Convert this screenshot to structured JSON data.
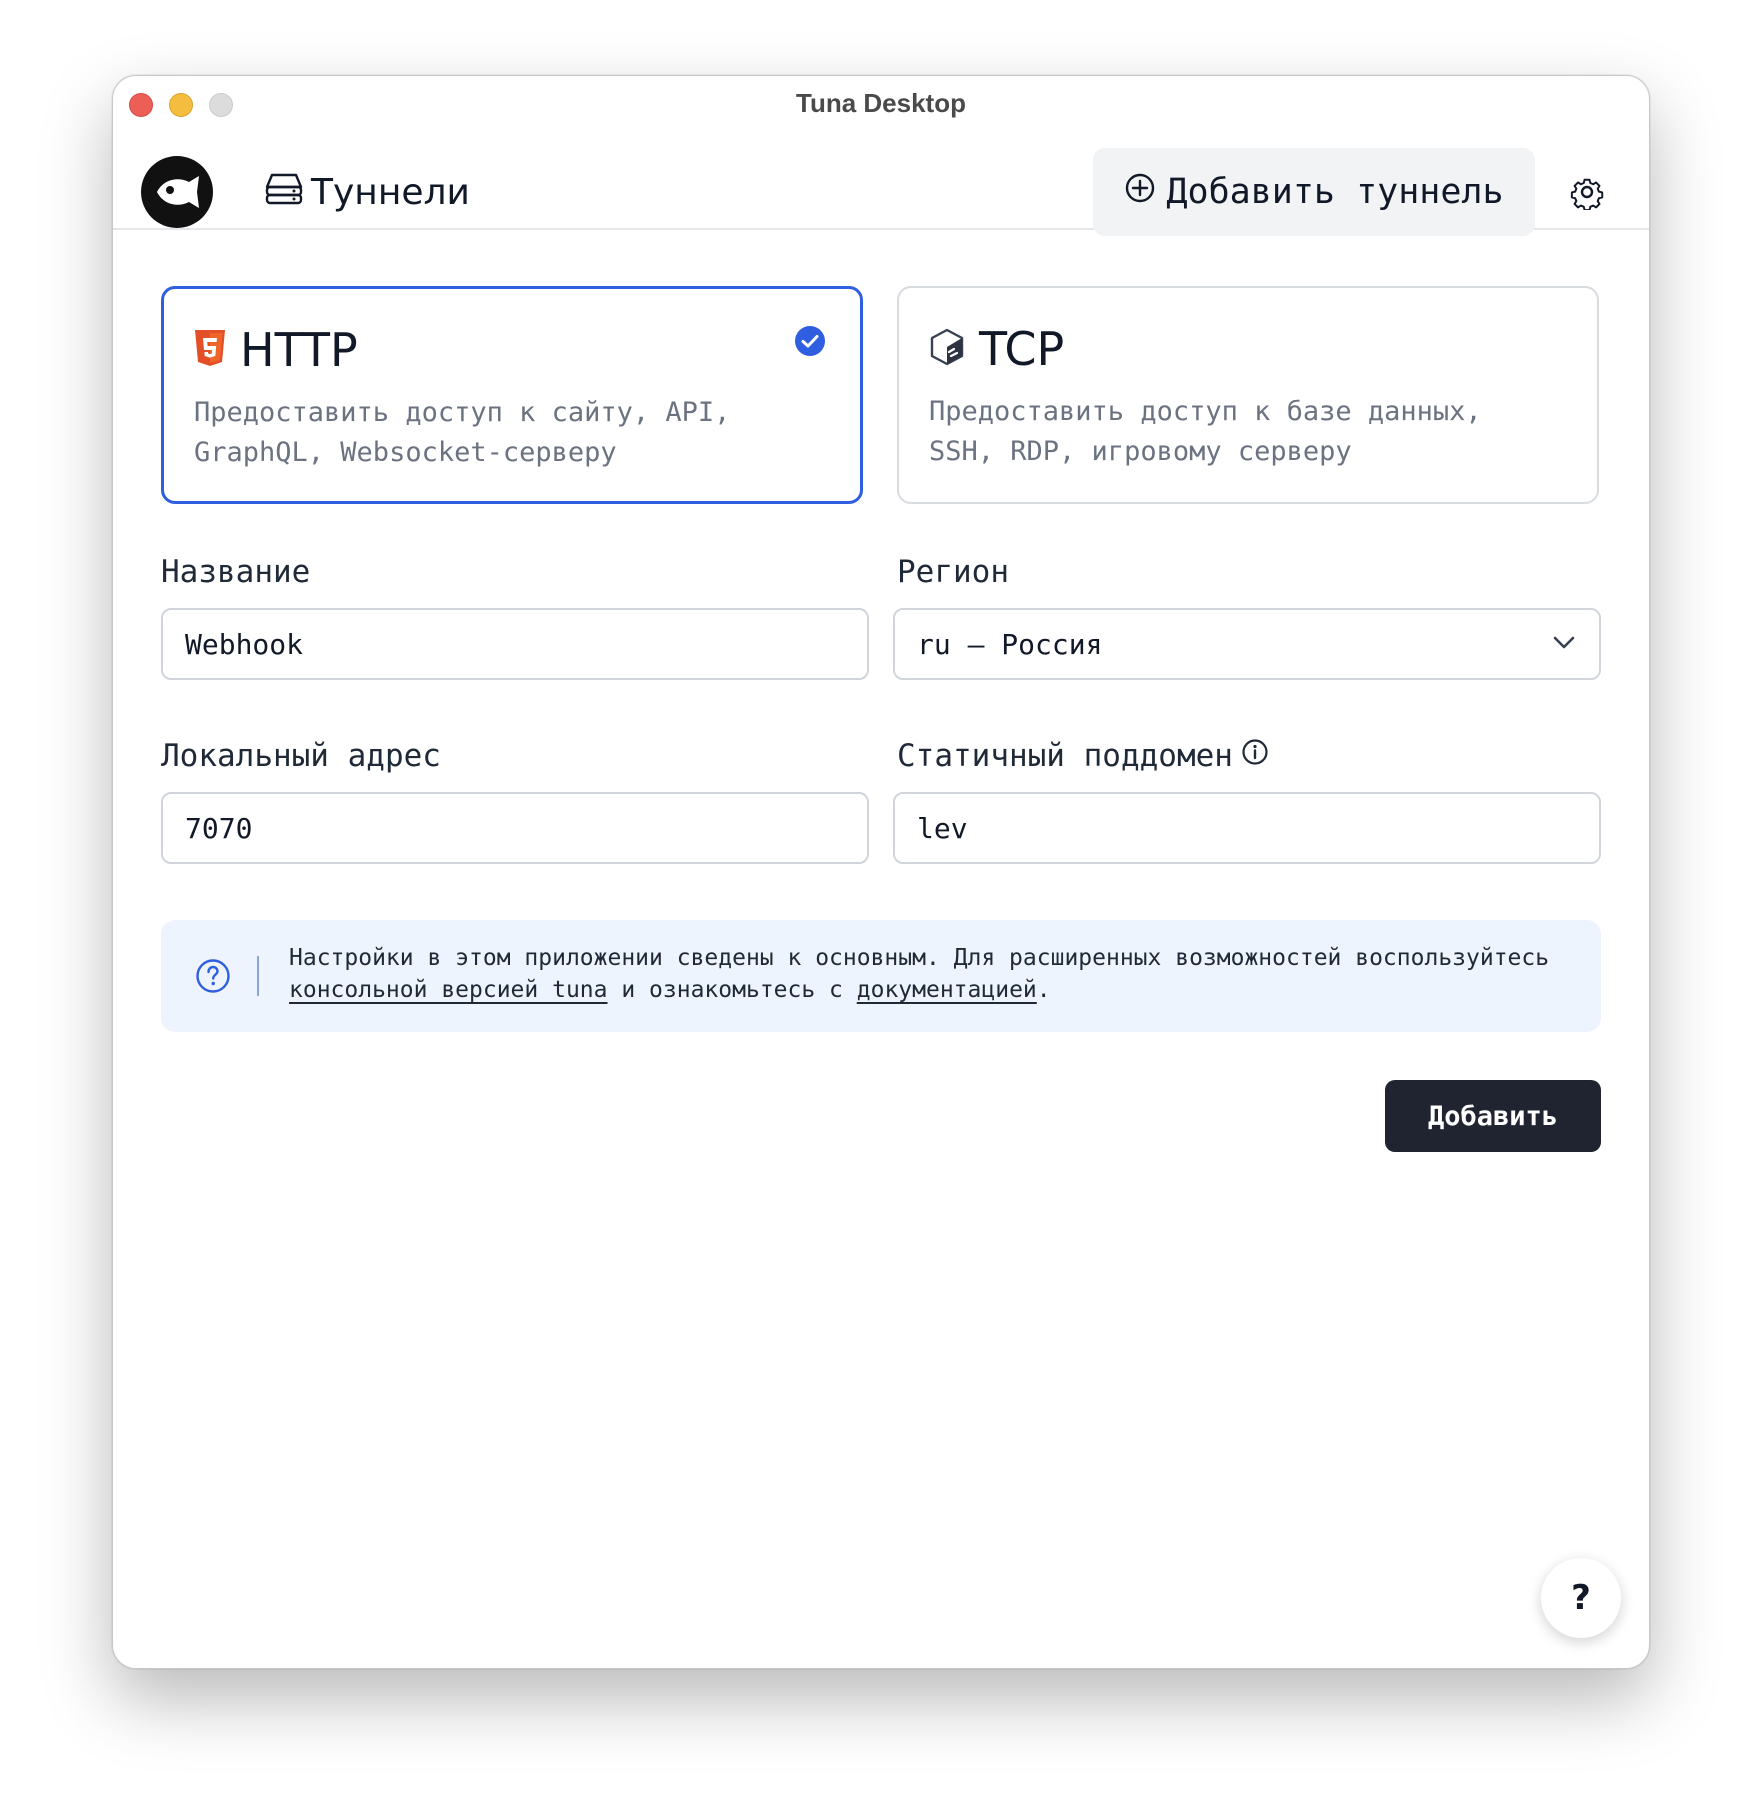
{
  "window": {
    "title": "Tuna Desktop"
  },
  "header": {
    "logo_icon": "fish-logo-icon",
    "nav_tunnels_label": "Туннели",
    "nav_tunnels_icon": "server-stack-icon",
    "add_tunnel_label": "Добавить туннель",
    "add_tunnel_icon": "plus-circle-icon",
    "settings_icon": "gear-icon"
  },
  "tunnel_types": [
    {
      "title": "HTTP",
      "icon": "html5-icon",
      "description": "Предоставить доступ к сайту, API,\nGraphQL, Websocket-серверу",
      "selected": true
    },
    {
      "title": "TCP",
      "icon": "terminal-cube-icon",
      "description": "Предоставить доступ к базе данных,\nSSH, RDP, игровому серверу",
      "selected": false
    }
  ],
  "form": {
    "name_label": "Название",
    "name_value": "Webhook",
    "region_label": "Регион",
    "region_value": "ru — Россия",
    "local_address_label": "Локальный адрес",
    "local_address_value": "7070",
    "subdomain_label": "Статичный поддомен",
    "subdomain_value": "lev"
  },
  "info": {
    "text_before": "Настройки в этом приложении сведены к основным. Для расширенных возможностей воспользуйтесь ",
    "link1": "консольной версией tuna",
    "text_middle": " и ознакомьтесь с ",
    "link2": "документацией",
    "text_after": "."
  },
  "actions": {
    "submit_label": "Добавить",
    "help_label": "?"
  },
  "colors": {
    "accent": "#2f5fe0",
    "submit_bg": "#1f2430",
    "info_bg": "#eef4fd",
    "html5": "#e34f26"
  }
}
